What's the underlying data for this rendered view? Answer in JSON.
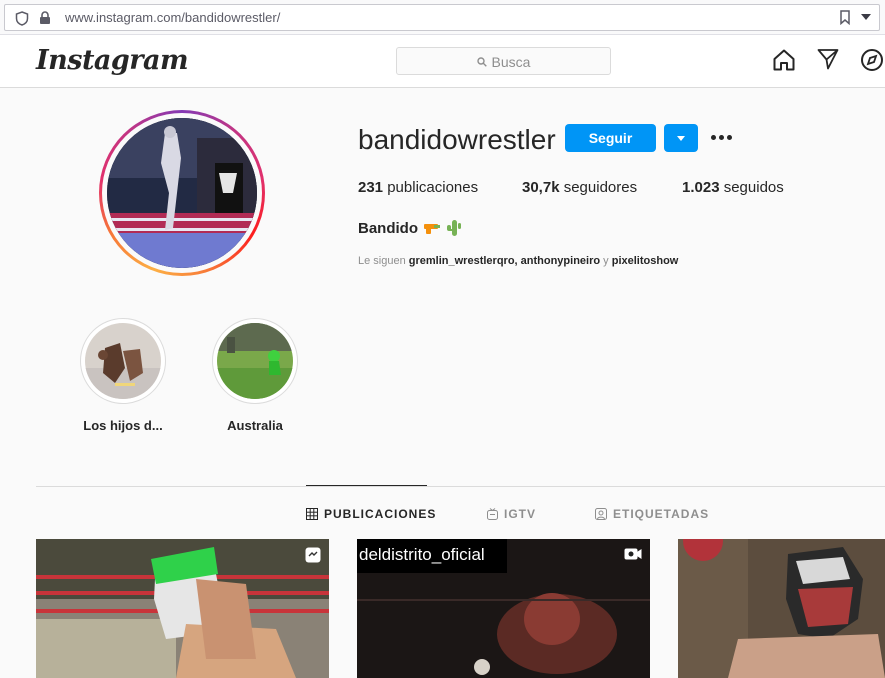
{
  "browser": {
    "url": "www.instagram.com/bandidowrestler/"
  },
  "header": {
    "logo": "Instagram",
    "search_placeholder": "Busca"
  },
  "profile": {
    "username": "bandidowrestler",
    "follow_label": "Seguir",
    "posts_count": "231",
    "posts_label": "publicaciones",
    "followers_count": "30,7k",
    "followers_label": "seguidores",
    "following_count": "1.023",
    "following_label": "seguidos",
    "full_name": "Bandido",
    "followed_by_prefix": "Le siguen",
    "followed_by_users": "gremlin_wrestlerqro, anthonypineiro",
    "followed_by_and": "y",
    "followed_by_last": "pixelitoshow"
  },
  "highlights": [
    {
      "label": "Los hijos d..."
    },
    {
      "label": "Australia"
    }
  ],
  "tabs": [
    {
      "label": "PUBLICACIONES",
      "icon": "grid-icon",
      "active": true
    },
    {
      "label": "IGTV",
      "icon": "igtv-icon",
      "active": false
    },
    {
      "label": "ETIQUETADAS",
      "icon": "tagged-icon",
      "active": false
    }
  ],
  "posts": [
    {
      "overlay_text": "",
      "badge": "reel-icon"
    },
    {
      "overlay_text": "deldistrito_oficial",
      "badge": "video-icon"
    },
    {
      "overlay_text": "",
      "badge": ""
    }
  ],
  "colors": {
    "follow_button": "#0095f6",
    "text_primary": "#262626",
    "text_secondary": "#8e8e8e"
  }
}
